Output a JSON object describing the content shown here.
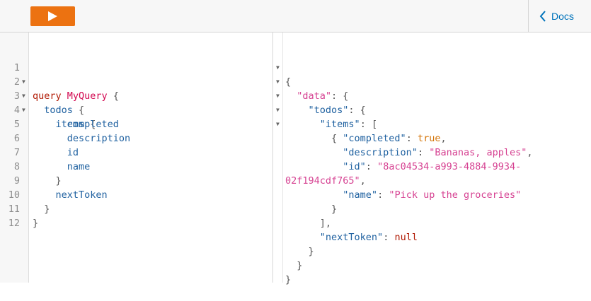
{
  "toolbar": {
    "run_icon": "play-icon",
    "docs_label": "Docs",
    "docs_icon": "chevron-left-icon",
    "accent": "#ec7211",
    "link_color": "#0073bb"
  },
  "query": {
    "line_numbers": [
      "1",
      "2",
      "3",
      "4",
      "5",
      "6",
      "7",
      "8",
      "9",
      "10",
      "11",
      "12"
    ],
    "tokens": {
      "query_kw": "query",
      "op_name": "MyQuery",
      "todos": "todos",
      "items": "items",
      "completed": "completed",
      "description": "description",
      "id": "id",
      "name": "name",
      "nextToken": "nextToken",
      "open_brace": "{",
      "close_brace": "}"
    }
  },
  "result": {
    "keys": {
      "data": "\"data\"",
      "todos": "\"todos\"",
      "items": "\"items\"",
      "completed": "\"completed\"",
      "description": "\"description\"",
      "id": "\"id\"",
      "name": "\"name\"",
      "nextToken": "\"nextToken\""
    },
    "values": {
      "completed": "true",
      "description": "\"Bananas, apples\"",
      "id_part1": "\"8ac04534-a993-4884-9934-",
      "id_part2": "02f194cdf765\"",
      "name": "\"Pick up the groceries\"",
      "nextToken": "null"
    }
  }
}
